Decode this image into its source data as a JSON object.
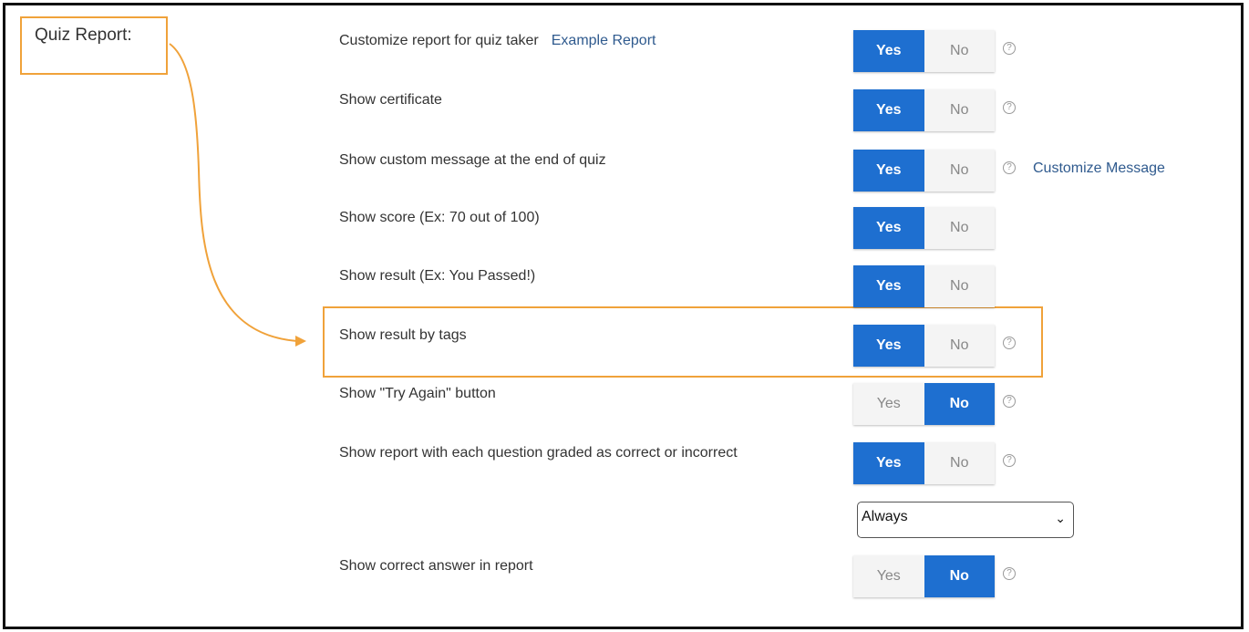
{
  "section_title": "Quiz Report:",
  "rows": [
    {
      "label": "Customize report for quiz taker",
      "link": "Example Report",
      "yes": "Yes",
      "no": "No",
      "help": "?",
      "value": "Yes"
    },
    {
      "label": "Show certificate",
      "yes": "Yes",
      "no": "No",
      "help": "?",
      "value": "Yes"
    },
    {
      "label": "Show custom message at the end of quiz",
      "yes": "Yes",
      "no": "No",
      "help": "?",
      "value": "Yes",
      "extra_link": "Customize Message"
    },
    {
      "label": "Show score (Ex: 70 out of 100)",
      "yes": "Yes",
      "no": "No",
      "value": "Yes"
    },
    {
      "label": "Show result (Ex: You Passed!)",
      "yes": "Yes",
      "no": "No",
      "value": "Yes"
    },
    {
      "label": "Show result by tags",
      "yes": "Yes",
      "no": "No",
      "help": "?",
      "value": "Yes"
    },
    {
      "label": "Show \"Try Again\" button",
      "yes": "Yes",
      "no": "No",
      "help": "?",
      "value": "No"
    },
    {
      "label": "Show report with each question graded as correct or incorrect",
      "yes": "Yes",
      "no": "No",
      "help": "?",
      "value": "Yes"
    },
    {
      "label": "Show correct answer in report",
      "yes": "Yes",
      "no": "No",
      "help": "?",
      "value": "No"
    }
  ],
  "graded_dropdown": {
    "selected": "Always"
  },
  "colors": {
    "accent": "#1e6fd0",
    "highlight": "#f0a23a",
    "link": "#2f5a8e"
  },
  "icons": {
    "help": "question-circle-icon",
    "dropdown": "chevron-down-icon",
    "annotation": "arrow-icon"
  }
}
